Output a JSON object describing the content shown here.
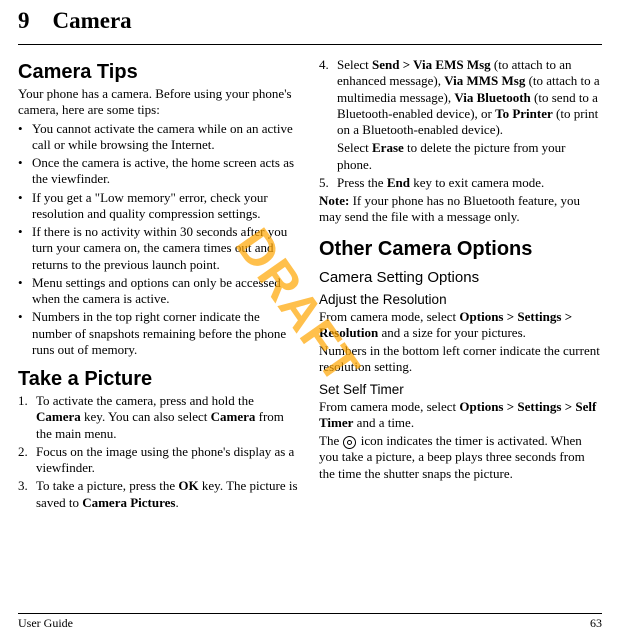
{
  "chapter": {
    "number": "9",
    "title": "Camera"
  },
  "watermark": "DRAFT",
  "left": {
    "section1": {
      "title": "Camera Tips",
      "intro": "Your phone has a camera. Before using your phone's camera, here are some tips:",
      "bullets": [
        "You cannot activate the camera while on an active call or while browsing the Internet.",
        "Once the camera is active, the home screen acts as the viewfinder.",
        "If you get a \"Low memory\" error, check your resolution and quality compression settings.",
        "If there is no activity within 30 seconds after you turn your camera on, the camera times out and returns to the previous launch point.",
        "Menu settings and options can only be accessed when the camera is active.",
        "Numbers in the top right corner indicate the number of snapshots remaining before the phone runs out of memory."
      ]
    },
    "section2": {
      "title": "Take a Picture",
      "steps": [
        {
          "n": "1.",
          "pre": "To activate the camera, press and hold the ",
          "b1": "Camera",
          "mid": " key. You can also select ",
          "b2": "Camera",
          "post": " from the main menu."
        },
        {
          "n": "2.",
          "text": "Focus on the image using the phone's display as a viewfinder."
        },
        {
          "n": "3.",
          "pre": "To take a picture, press the ",
          "b1": "OK",
          "mid": " key. The picture is saved to ",
          "b2": "Camera Pictures",
          "post": "."
        }
      ]
    }
  },
  "right": {
    "step4": {
      "n": "4.",
      "pre": "Select ",
      "b1": "Send > Via EMS Msg",
      "t1": " (to attach to an enhanced message), ",
      "b2": "Via MMS Msg",
      "t2": " (to attach to a multimedia message), ",
      "b3": "Via Bluetooth",
      "t3": " (to send to a Bluetooth-enabled device), or ",
      "b4": "To Printer",
      "t4": " (to print on a Bluetooth-enabled device)."
    },
    "step4b": {
      "pre": "Select ",
      "b": "Erase",
      "post": " to delete the picture from your phone."
    },
    "step5": {
      "n": "5.",
      "pre": "Press the ",
      "b": "End",
      "post": " key to exit camera mode."
    },
    "note": {
      "label": "Note:",
      "text": " If your phone has no Bluetooth feature, you may send the file with a message only."
    },
    "section3": {
      "title": "Other Camera Options",
      "sub1": {
        "title": "Camera Setting Options"
      },
      "sub1a": {
        "title": "Adjust the Resolution",
        "pre": "From camera mode, select ",
        "b": "Options > Settings > Resolution",
        "post": " and a size for your pictures.",
        "p2": "Numbers in the bottom left corner indicate the current resolution setting."
      },
      "sub1b": {
        "title": "Set Self Timer",
        "pre": "From camera mode, select ",
        "b": "Options > Settings > Self Timer",
        "post": " and a time.",
        "p2a": "The ",
        "p2b": " icon indicates the timer is activated. When you take a picture, a beep plays three seconds from the time the shutter snaps the picture."
      }
    }
  },
  "footer": {
    "left": "User Guide",
    "right": "63"
  }
}
